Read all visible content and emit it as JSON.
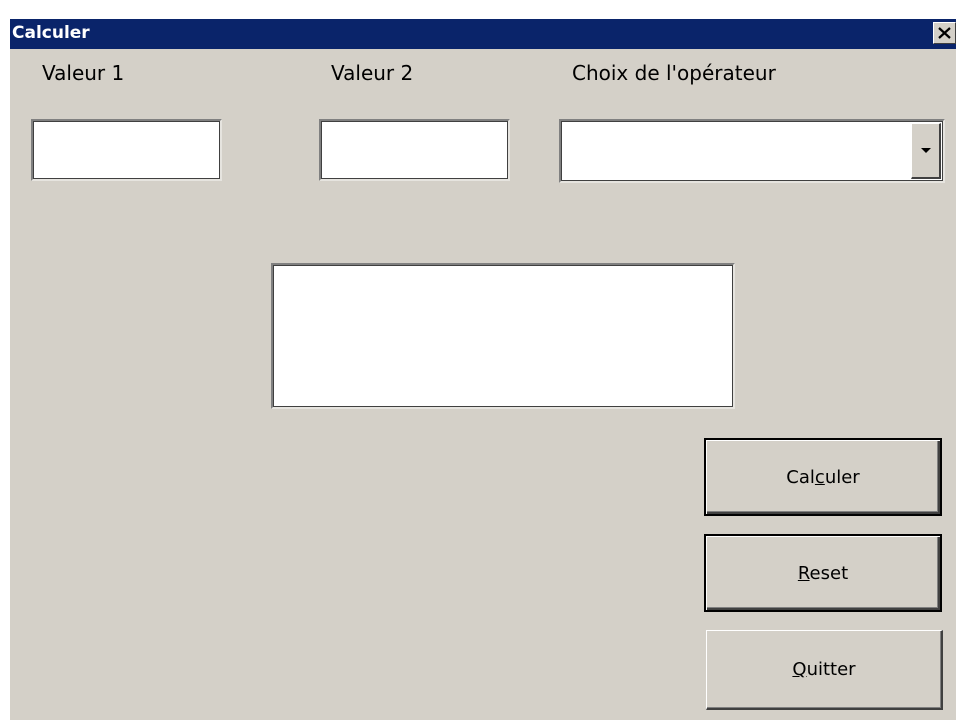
{
  "window": {
    "title": "Calculer",
    "close_symbol": "✕"
  },
  "labels": {
    "value1": "Valeur 1",
    "value2": "Valeur 2",
    "operator": "Choix de l'opérateur"
  },
  "fields": {
    "value1": "",
    "value2": "",
    "operator_selected": "",
    "result": ""
  },
  "buttons": {
    "calculate": {
      "pre": "Cal",
      "accel": "c",
      "post": "uler"
    },
    "reset": {
      "pre": "",
      "accel": "R",
      "post": "eset"
    },
    "quit": {
      "pre": "",
      "accel": "Q",
      "post": "uitter"
    }
  },
  "colors": {
    "titlebar": "#0a246a",
    "face": "#d4d0c8"
  },
  "icons": {
    "close": "close-icon",
    "dropdown": "chevron-down-icon"
  }
}
